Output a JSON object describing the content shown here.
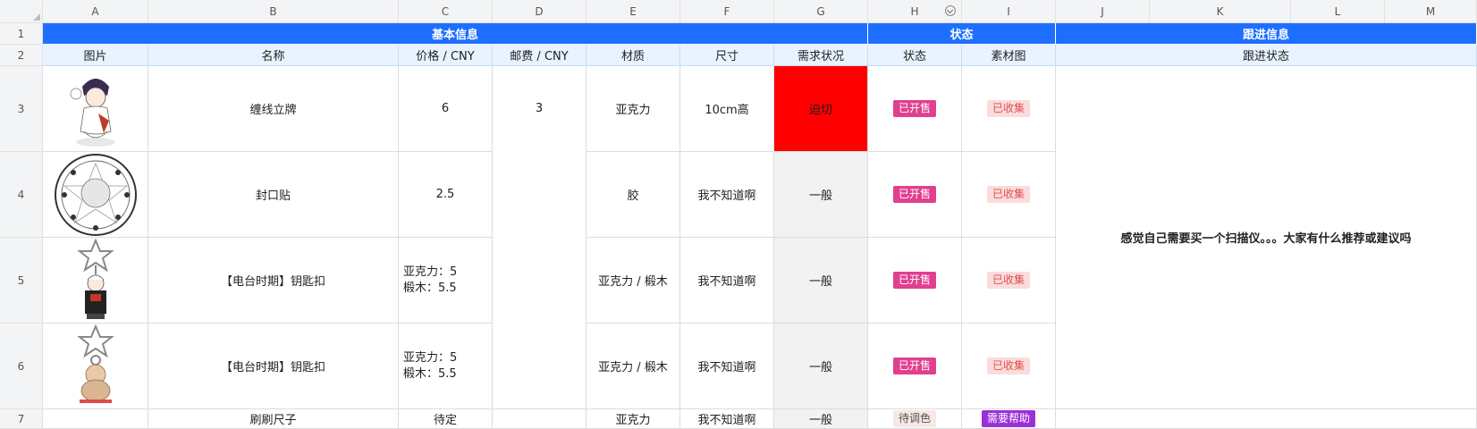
{
  "columns": [
    "A",
    "B",
    "C",
    "D",
    "E",
    "F",
    "G",
    "H",
    "I",
    "J",
    "K",
    "L",
    "M"
  ],
  "rows": [
    "1",
    "2",
    "3",
    "4",
    "5",
    "6",
    "7"
  ],
  "groups": {
    "basic": "基本信息",
    "status": "状态",
    "follow": "跟进信息"
  },
  "subheaders": {
    "image": "图片",
    "name": "名称",
    "price": "价格 / CNY",
    "shipping": "邮费 / CNY",
    "material": "材质",
    "size": "尺寸",
    "demand": "需求状况",
    "state": "状态",
    "asset": "素材图",
    "follow": "跟进状态"
  },
  "shipping_value": "3",
  "follow_note": "感觉自己需要买一个扫描仪。。。大家有什么推荐或建议吗",
  "items": [
    {
      "image_icon": "character-sticker-icon",
      "name": "缠线立牌",
      "price_lines": [
        "6"
      ],
      "material": "亚克力",
      "size": "10cm高",
      "demand": "迫切",
      "state": "已开售",
      "asset": "已收集"
    },
    {
      "image_icon": "round-seal-icon",
      "name": "封口贴",
      "price_lines": [
        "2.5"
      ],
      "material": "胶",
      "size": "我不知道啊",
      "demand": "一般",
      "state": "已开售",
      "asset": "已收集"
    },
    {
      "image_icon": "star-keychain-icon",
      "name": "【电台时期】钥匙扣",
      "price_lines": [
        "亚克力：5",
        "椴木：5.5"
      ],
      "material": "亚克力 / 椴木",
      "size": "我不知道啊",
      "demand": "一般",
      "state": "已开售",
      "asset": "已收集"
    },
    {
      "image_icon": "star-keychain-icon",
      "name": "【电台时期】钥匙扣",
      "price_lines": [
        "亚克力：5",
        "椴木：5.5"
      ],
      "material": "亚克力 / 椴木",
      "size": "我不知道啊",
      "demand": "一般",
      "state": "已开售",
      "asset": "已收集"
    },
    {
      "image_icon": "",
      "name": "刷刷尺子",
      "price_lines": [
        "待定"
      ],
      "material": "亚克力",
      "size": "我不知道啊",
      "demand": "一般",
      "state": "待调色",
      "asset": "需要帮助"
    }
  ],
  "colors": {
    "header_blue": "#1e6fff",
    "subheader_blue": "#e8f3ff",
    "urgent_red": "#ff0000",
    "tag_on_sale": "#e0408f",
    "tag_collected": "#fbdcdc",
    "tag_pending": "#f6e8e3",
    "tag_help": "#9b30d8"
  }
}
